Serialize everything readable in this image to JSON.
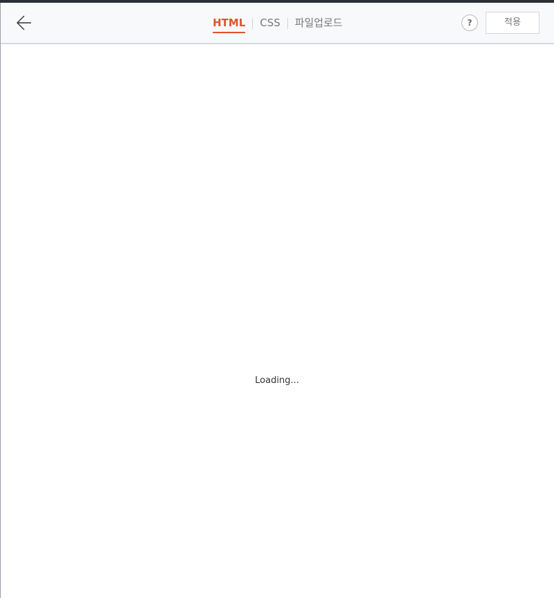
{
  "header": {
    "back_icon": "arrow-left-icon",
    "tabs": [
      {
        "label": "HTML",
        "active": true
      },
      {
        "label": "CSS",
        "active": false
      },
      {
        "label": "파일업로드",
        "active": false
      }
    ],
    "help_label": "?",
    "apply_label": "적용"
  },
  "main": {
    "loading_text": "Loading..."
  },
  "colors": {
    "accent": "#e0532b",
    "header_bg": "#f8f9fb",
    "top_bar": "#2b2f36"
  }
}
